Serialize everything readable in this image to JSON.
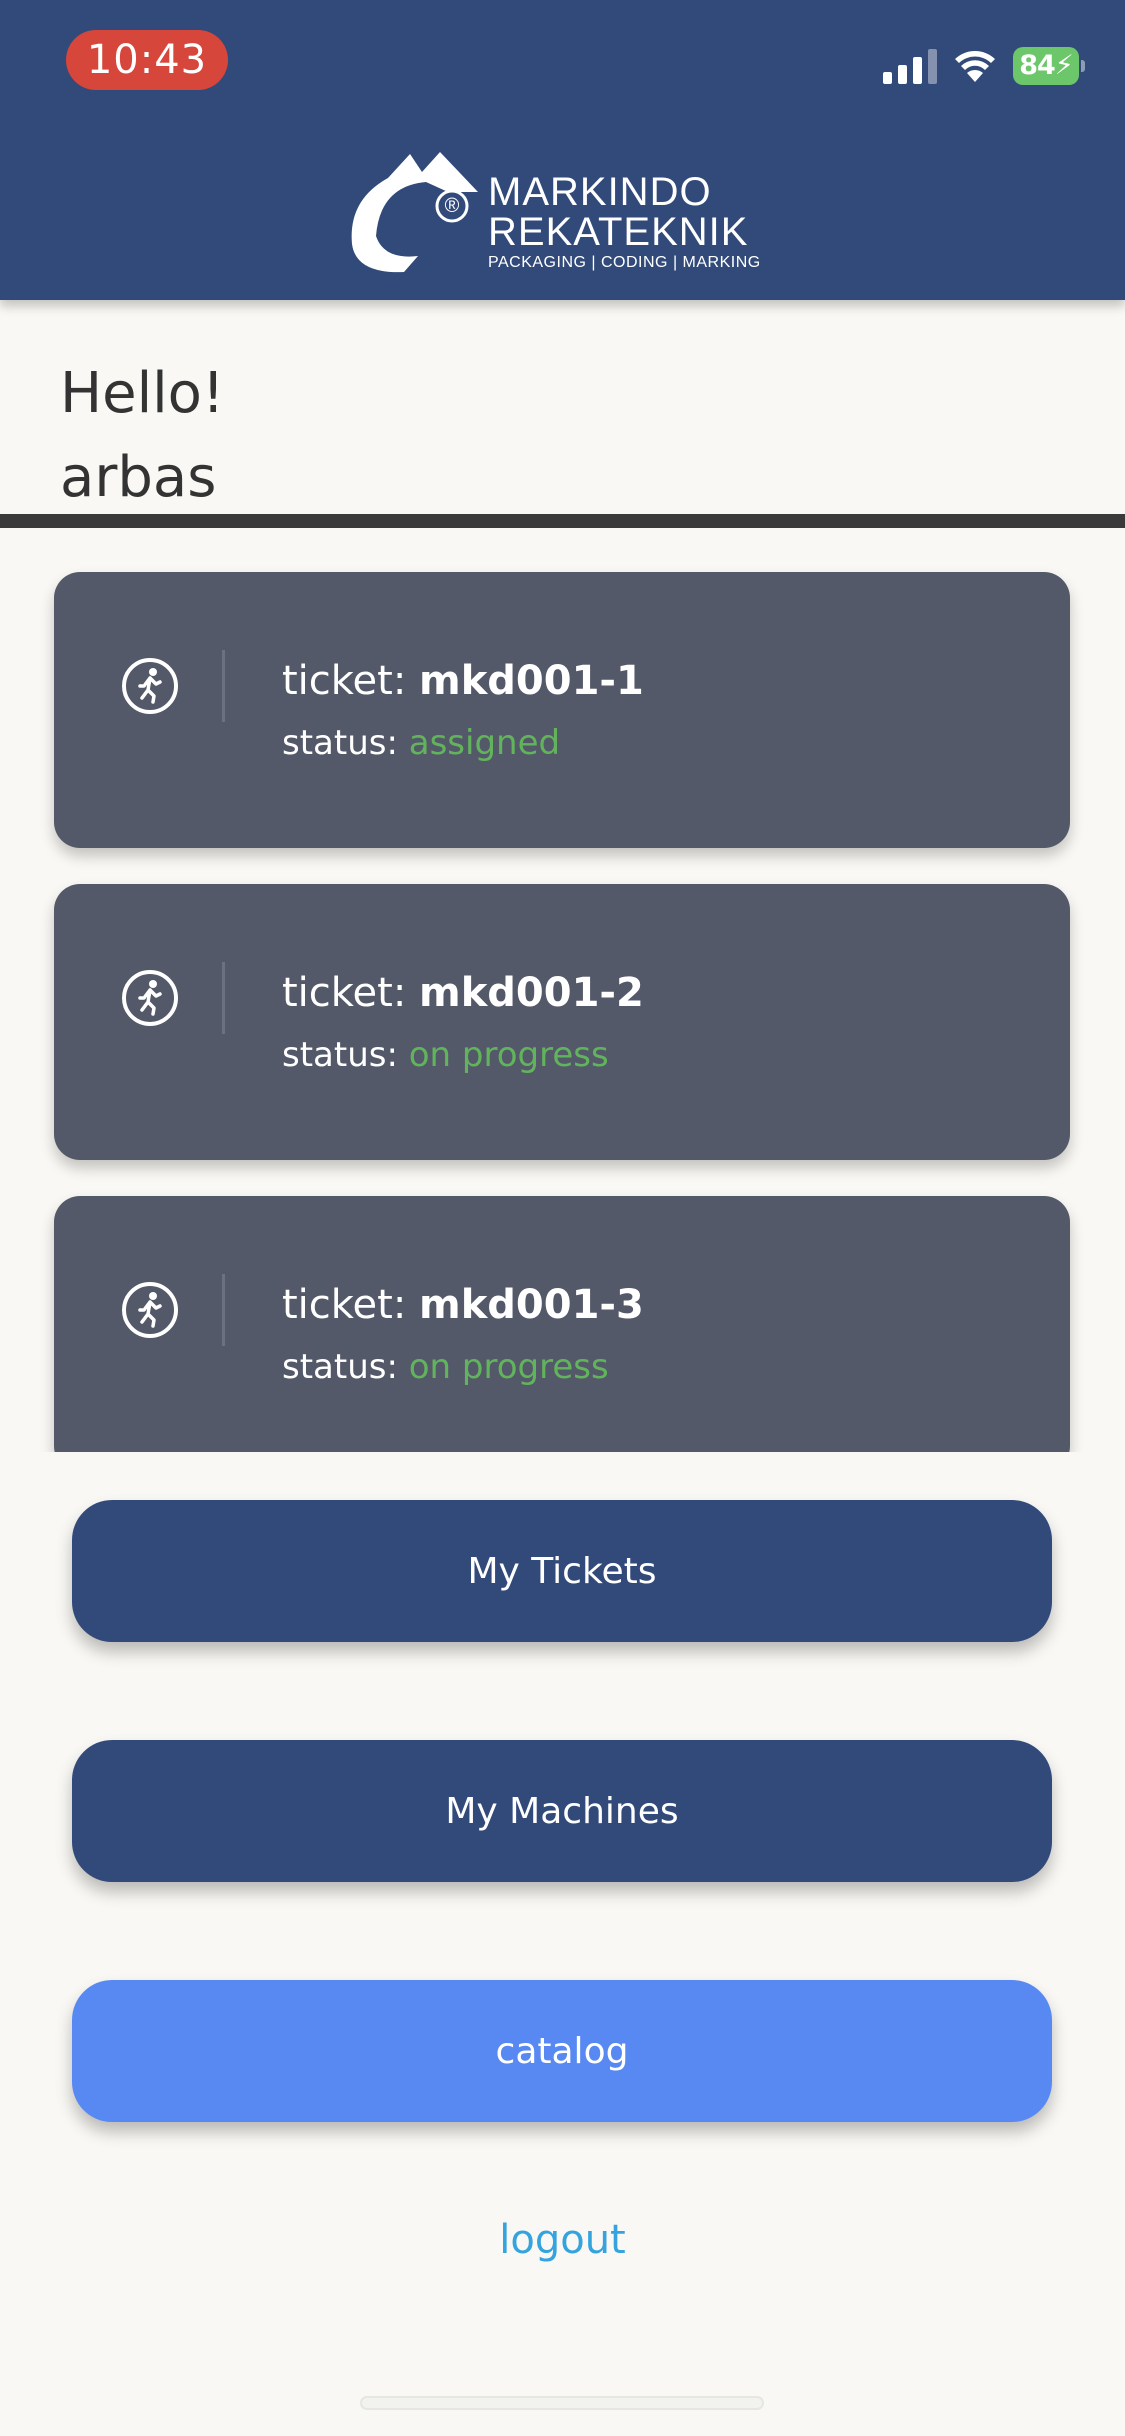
{
  "status_bar": {
    "time": "10:43",
    "battery": "84",
    "icons": [
      "cellular-signal-icon",
      "wifi-icon",
      "battery-charging-icon"
    ]
  },
  "header": {
    "background_color": "#324a7a",
    "logo": {
      "line1": "MARKINDO",
      "line2": "REKATEKNIK",
      "tagline": "PACKAGING | CODING | MARKING",
      "mark": "®"
    }
  },
  "greeting": {
    "hello": "Hello!",
    "user": "arbas"
  },
  "tickets": [
    {
      "label": "ticket:",
      "id": "mkd001-1",
      "status_label": "status:",
      "status": "assigned",
      "icon": "running-person-icon"
    },
    {
      "label": "ticket:",
      "id": "mkd001-2",
      "status_label": "status:",
      "status": "on progress",
      "icon": "running-person-icon"
    },
    {
      "label": "ticket:",
      "id": "mkd001-3",
      "status_label": "status:",
      "status": "on progress",
      "icon": "running-person-icon"
    }
  ],
  "buttons": {
    "my_tickets": "My Tickets",
    "my_machines": "My Machines",
    "catalog": "catalog",
    "logout": "logout"
  },
  "colors": {
    "primary": "#324a7a",
    "catalog_button": "#5889f3",
    "card": "#545969",
    "status_text": "#62b45c",
    "link": "#35a4de"
  }
}
